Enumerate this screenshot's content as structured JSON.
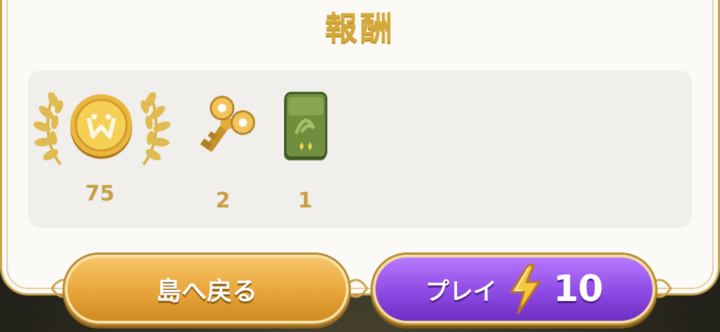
{
  "title": "報酬",
  "rewards": [
    {
      "name": "coin",
      "count": "75"
    },
    {
      "name": "wind-up-key",
      "count": "2"
    },
    {
      "name": "green-card-pack",
      "count": "1"
    }
  ],
  "buttons": {
    "back_label": "島へ戻る",
    "play_label": "プレイ",
    "play_cost": "10"
  },
  "colors": {
    "gold": "#d4a93a",
    "play_purple": "#8e4ae4",
    "back_orange": "#e8a43a"
  },
  "icons": [
    "laurel-icon",
    "coin-icon",
    "key-icon",
    "card-pack-icon",
    "lightning-icon"
  ]
}
